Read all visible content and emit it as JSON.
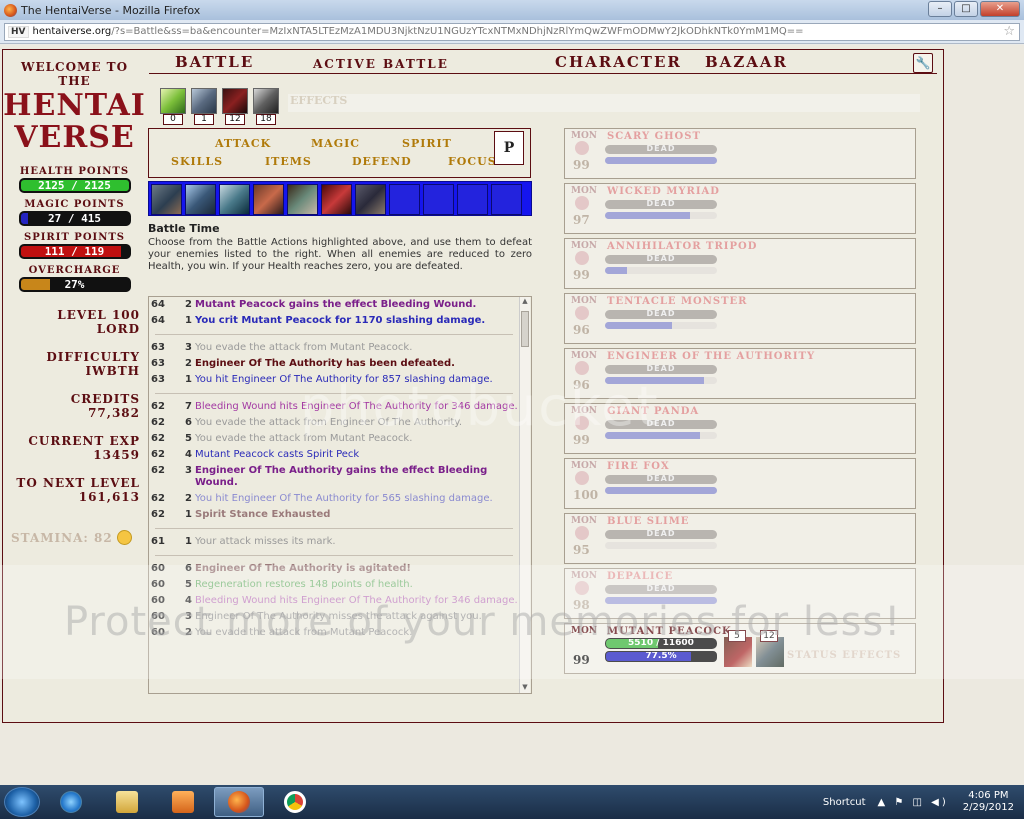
{
  "window": {
    "title": "The HentaiVerse - Mozilla Firefox",
    "buttons": [
      "–",
      "□",
      "✕"
    ]
  },
  "browser": {
    "url_host": "hentaiverse.org",
    "url_rest": "/?s=Battle&ss=ba&encounter=MzIxNTA5LTEzMzA1MDU3NjktNzU1NGUzYTcxNTMxNDhjNzRlYmQwZWFmODMwY2JkODhkNTk0YmM1MQ==",
    "site_icon": "HV"
  },
  "sidebar": {
    "welcome": "WELCOME TO THE",
    "logo_line1": "HENTAI",
    "logo_line2": "VERSE",
    "health_label": "HEALTH POINTS",
    "health_value": "2125 / 2125",
    "health_fraction": 1.0,
    "magic_label": "MAGIC POINTS",
    "magic_value": "27 / 415",
    "magic_fraction": 0.065,
    "spirit_label": "SPIRIT POINTS",
    "spirit_value": "111 / 119",
    "spirit_fraction": 0.93,
    "overcharge_label": "OVERCHARGE",
    "overcharge_value": "27%",
    "overcharge_fraction": 0.27,
    "level_label": "LEVEL 100",
    "level_title": "LORD",
    "difficulty_label": "DIFFICULTY",
    "difficulty_value": "IWBTH",
    "credits_label": "CREDITS",
    "credits_value": "77,382",
    "exp_label": "CURRENT EXP",
    "exp_value": "13459",
    "next_label": "TO NEXT LEVEL",
    "next_value": "161,613",
    "stamina": "STAMINA: 82"
  },
  "topnav": {
    "battle": "BATTLE",
    "active": "ACTIVE BATTLE",
    "character": "CHARACTER",
    "bazaar": "BAZAAR",
    "settings_icon": "wrench-icon"
  },
  "effects": {
    "counts": [
      "0",
      "1",
      "12",
      "18"
    ],
    "label": "EFFECTS"
  },
  "actions": {
    "attack": "ATTACK",
    "magic": "MAGIC",
    "spirit": "SPIRIT",
    "skills": "SKILLS",
    "items": "ITEMS",
    "defend": "DEFEND",
    "focus": "FOCUS",
    "p": "P"
  },
  "battle": {
    "title": "Battle Time",
    "text": "Choose from the Battle Actions highlighted above, and use them to defeat your enemies listed to the right. When all enemies are reduced to zero Health, you win. If your Health reaches zero, you are defeated."
  },
  "log": [
    {
      "t": "64",
      "a": "2",
      "m": "Mutant Peacock gains the effect Bleeding Wound.",
      "c": "#7a1f8a",
      "b": true
    },
    {
      "t": "64",
      "a": "1",
      "m": "You crit Mutant Peacock for 1170 slashing damage.",
      "c": "#2a2ab8",
      "b": true,
      "sep": true
    },
    {
      "t": "63",
      "a": "3",
      "m": "You evade the attack from Mutant Peacock.",
      "c": "#9a9a9a",
      "b": false
    },
    {
      "t": "63",
      "a": "2",
      "m": "Engineer Of The Authority has been defeated.",
      "c": "#5c0d12",
      "b": true
    },
    {
      "t": "63",
      "a": "1",
      "m": "You hit Engineer Of The Authority for 857 slashing damage.",
      "c": "#2a2ab8",
      "b": false,
      "sep": true
    },
    {
      "t": "62",
      "a": "7",
      "m": "Bleeding Wound hits Engineer Of The Authority for 346 damage.",
      "c": "#a33aa3",
      "b": false
    },
    {
      "t": "62",
      "a": "6",
      "m": "You evade the attack from Engineer Of The Authority.",
      "c": "#9a9a9a",
      "b": false
    },
    {
      "t": "62",
      "a": "5",
      "m": "You evade the attack from Mutant Peacock.",
      "c": "#9a9a9a",
      "b": false
    },
    {
      "t": "62",
      "a": "4",
      "m": "Mutant Peacock casts Spirit Peck",
      "c": "#2a2ab8",
      "b": false
    },
    {
      "t": "62",
      "a": "3",
      "m": "Engineer Of The Authority gains the effect Bleeding Wound.",
      "c": "#7a1f8a",
      "b": true
    },
    {
      "t": "62",
      "a": "2",
      "m": "You hit Engineer Of The Authority for 565 slashing damage.",
      "c": "#8a8ad0",
      "b": false
    },
    {
      "t": "62",
      "a": "1",
      "m": "Spirit Stance Exhausted",
      "c": "#9a7a7a",
      "b": true,
      "sep": true
    },
    {
      "t": "61",
      "a": "1",
      "m": "Your attack misses its mark.",
      "c": "#9a9a9a",
      "b": false,
      "sep": true
    },
    {
      "t": "60",
      "a": "6",
      "m": "Engineer Of The Authority is agitated!",
      "c": "#9a7a7a",
      "b": true
    },
    {
      "t": "60",
      "a": "5",
      "m": "Regeneration restores 148 points of health.",
      "c": "#7ab87a",
      "b": false
    },
    {
      "t": "60",
      "a": "4",
      "m": "Bleeding Wound hits Engineer Of The Authority for 346 damage.",
      "c": "#c080c0",
      "b": false
    },
    {
      "t": "60",
      "a": "3",
      "m": "Engineer Of The Authority misses the attack against you.",
      "c": "#9a9a9a",
      "b": false
    },
    {
      "t": "60",
      "a": "2",
      "m": "You evade the attack from Mutant Peacock.",
      "c": "#9a9a9a",
      "b": false
    }
  ],
  "monsters": [
    {
      "tag": "MON",
      "level": "99",
      "name": "SCARY GHOST",
      "hp_text": "DEAD",
      "mp_fraction": 1.0
    },
    {
      "tag": "MON",
      "level": "97",
      "name": "WICKED MYRIAD",
      "hp_text": "DEAD",
      "mp_fraction": 0.76
    },
    {
      "tag": "MON",
      "level": "99",
      "name": "ANNIHILATOR TRIPOD",
      "hp_text": "DEAD",
      "mp_fraction": 0.2
    },
    {
      "tag": "MON",
      "level": "96",
      "name": "TENTACLE MONSTER",
      "hp_text": "DEAD",
      "mp_fraction": 0.6
    },
    {
      "tag": "MON",
      "level": "96",
      "name": "ENGINEER OF THE AUTHORITY",
      "hp_text": "DEAD",
      "mp_fraction": 0.88
    },
    {
      "tag": "MON",
      "level": "99",
      "name": "GIANT PANDA",
      "hp_text": "DEAD",
      "mp_fraction": 0.85
    },
    {
      "tag": "MON",
      "level": "100",
      "name": "FIRE FOX",
      "hp_text": "DEAD",
      "mp_fraction": 1.0
    },
    {
      "tag": "MON",
      "level": "95",
      "name": "BLUE SLIME",
      "hp_text": "DEAD",
      "mp_fraction": 0.0
    },
    {
      "tag": "MON",
      "level": "98",
      "name": "DEPALICE",
      "hp_text": "DEAD",
      "mp_fraction": 1.0
    },
    {
      "tag": "MON",
      "level": "99",
      "name": "MUTANT PEACOCK",
      "hp_text": "5510 / 11600",
      "hp_fraction": 0.475,
      "mp_text": "77.5%",
      "mp_fraction": 0.775,
      "alive": true,
      "effects": [
        "5",
        "12"
      ],
      "effects_label": "STATUS EFFECTS"
    }
  ],
  "watermark": {
    "line1": "photobucket",
    "line2": "Protect more of your memories for less!"
  },
  "taskbar": {
    "shortcut": "Shortcut",
    "time": "4:06 PM",
    "date": "2/29/2012",
    "tray": "▲ ⚑ ◫ ◀)"
  },
  "colors": {
    "health": "#2fbf2f",
    "magic": "#2424c0",
    "spirit": "#c01010",
    "overcharge": "#c8861a",
    "accent": "#5c0d12"
  }
}
